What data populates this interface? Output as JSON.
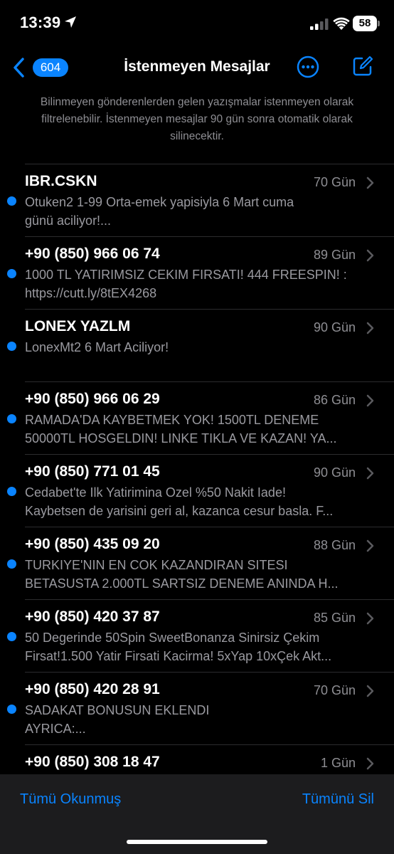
{
  "status_bar": {
    "time": "13:39",
    "battery": "58"
  },
  "nav": {
    "back_count": "604",
    "title": "İstenmeyen Mesajlar",
    "accent_color": "#0a84ff"
  },
  "info": {
    "text": "Bilinmeyen gönderenlerden gelen yazışmalar istenmeyen olarak filtrelenebilir. İstenmeyen mesajlar 90 gün sonra otomatik olarak silinecektir."
  },
  "messages": [
    {
      "sender": "IBR.CSKN",
      "date": "70 Gün",
      "line1": "Otuken2 1-99 Orta-emek yapisiyla 6 Mart cuma",
      "line2": "günü aciliyor!...",
      "unread": true
    },
    {
      "sender": "+90 (850) 966 06 74",
      "date": "89 Gün",
      "line1": "1000 TL YATIRIMSIZ CEKIM FIRSATI! 444 FREESPIN! :",
      "line2": "https://cutt.ly/8tEX4268",
      "unread": true
    },
    {
      "sender": "LONEX YAZLM",
      "date": "90 Gün",
      "line1": "LonexMt2 6 Mart Aciliyor!",
      "line2": "",
      "unread": true
    },
    {
      "sender": "+90 (850) 966 06 29",
      "date": "86 Gün",
      "line1": "RAMADA'DA KAYBETMEK YOK! 1500TL DENEME",
      "line2": "50000TL HOSGELDIN! LINKE TIKLA VE KAZAN! YA...",
      "unread": true
    },
    {
      "sender": "+90 (850) 771 01 45",
      "date": "90 Gün",
      "line1": "Cedabet'te Ilk Yatirimina Ozel %50 Nakit Iade!",
      "line2": "Kaybetsen de yarisini geri al, kazanca cesur basla. F...",
      "unread": true
    },
    {
      "sender": "+90 (850) 435 09 20",
      "date": "88 Gün",
      "line1": "TURKIYE'NIN EN COK KAZANDIRAN SITESI",
      "line2": "BETASUSTA 2.000TL SARTSIZ DENEME ANINDA H...",
      "unread": true
    },
    {
      "sender": "+90 (850) 420 37 87",
      "date": "85 Gün",
      "line1": "50 Degerinde 50Spin SweetBonanza Sinirsiz Çekim",
      "line2": "Firsat!1.500  Yatir Firsati Kacirma! 5xYap 10xÇek Akt...",
      "unread": true
    },
    {
      "sender": "+90 (850) 420 28 91",
      "date": "70 Gün",
      "line1": "SADAKAT BONUSUN EKLENDI",
      "line2": "AYRICA:...",
      "unread": true
    },
    {
      "sender": "+90 (850) 308 18 47",
      "date": "1 Gün",
      "line1": "",
      "line2": "",
      "unread": true
    }
  ],
  "toolbar": {
    "mark_all_read": "Tümü Okunmuş",
    "delete_all": "Tümünü Sil"
  }
}
